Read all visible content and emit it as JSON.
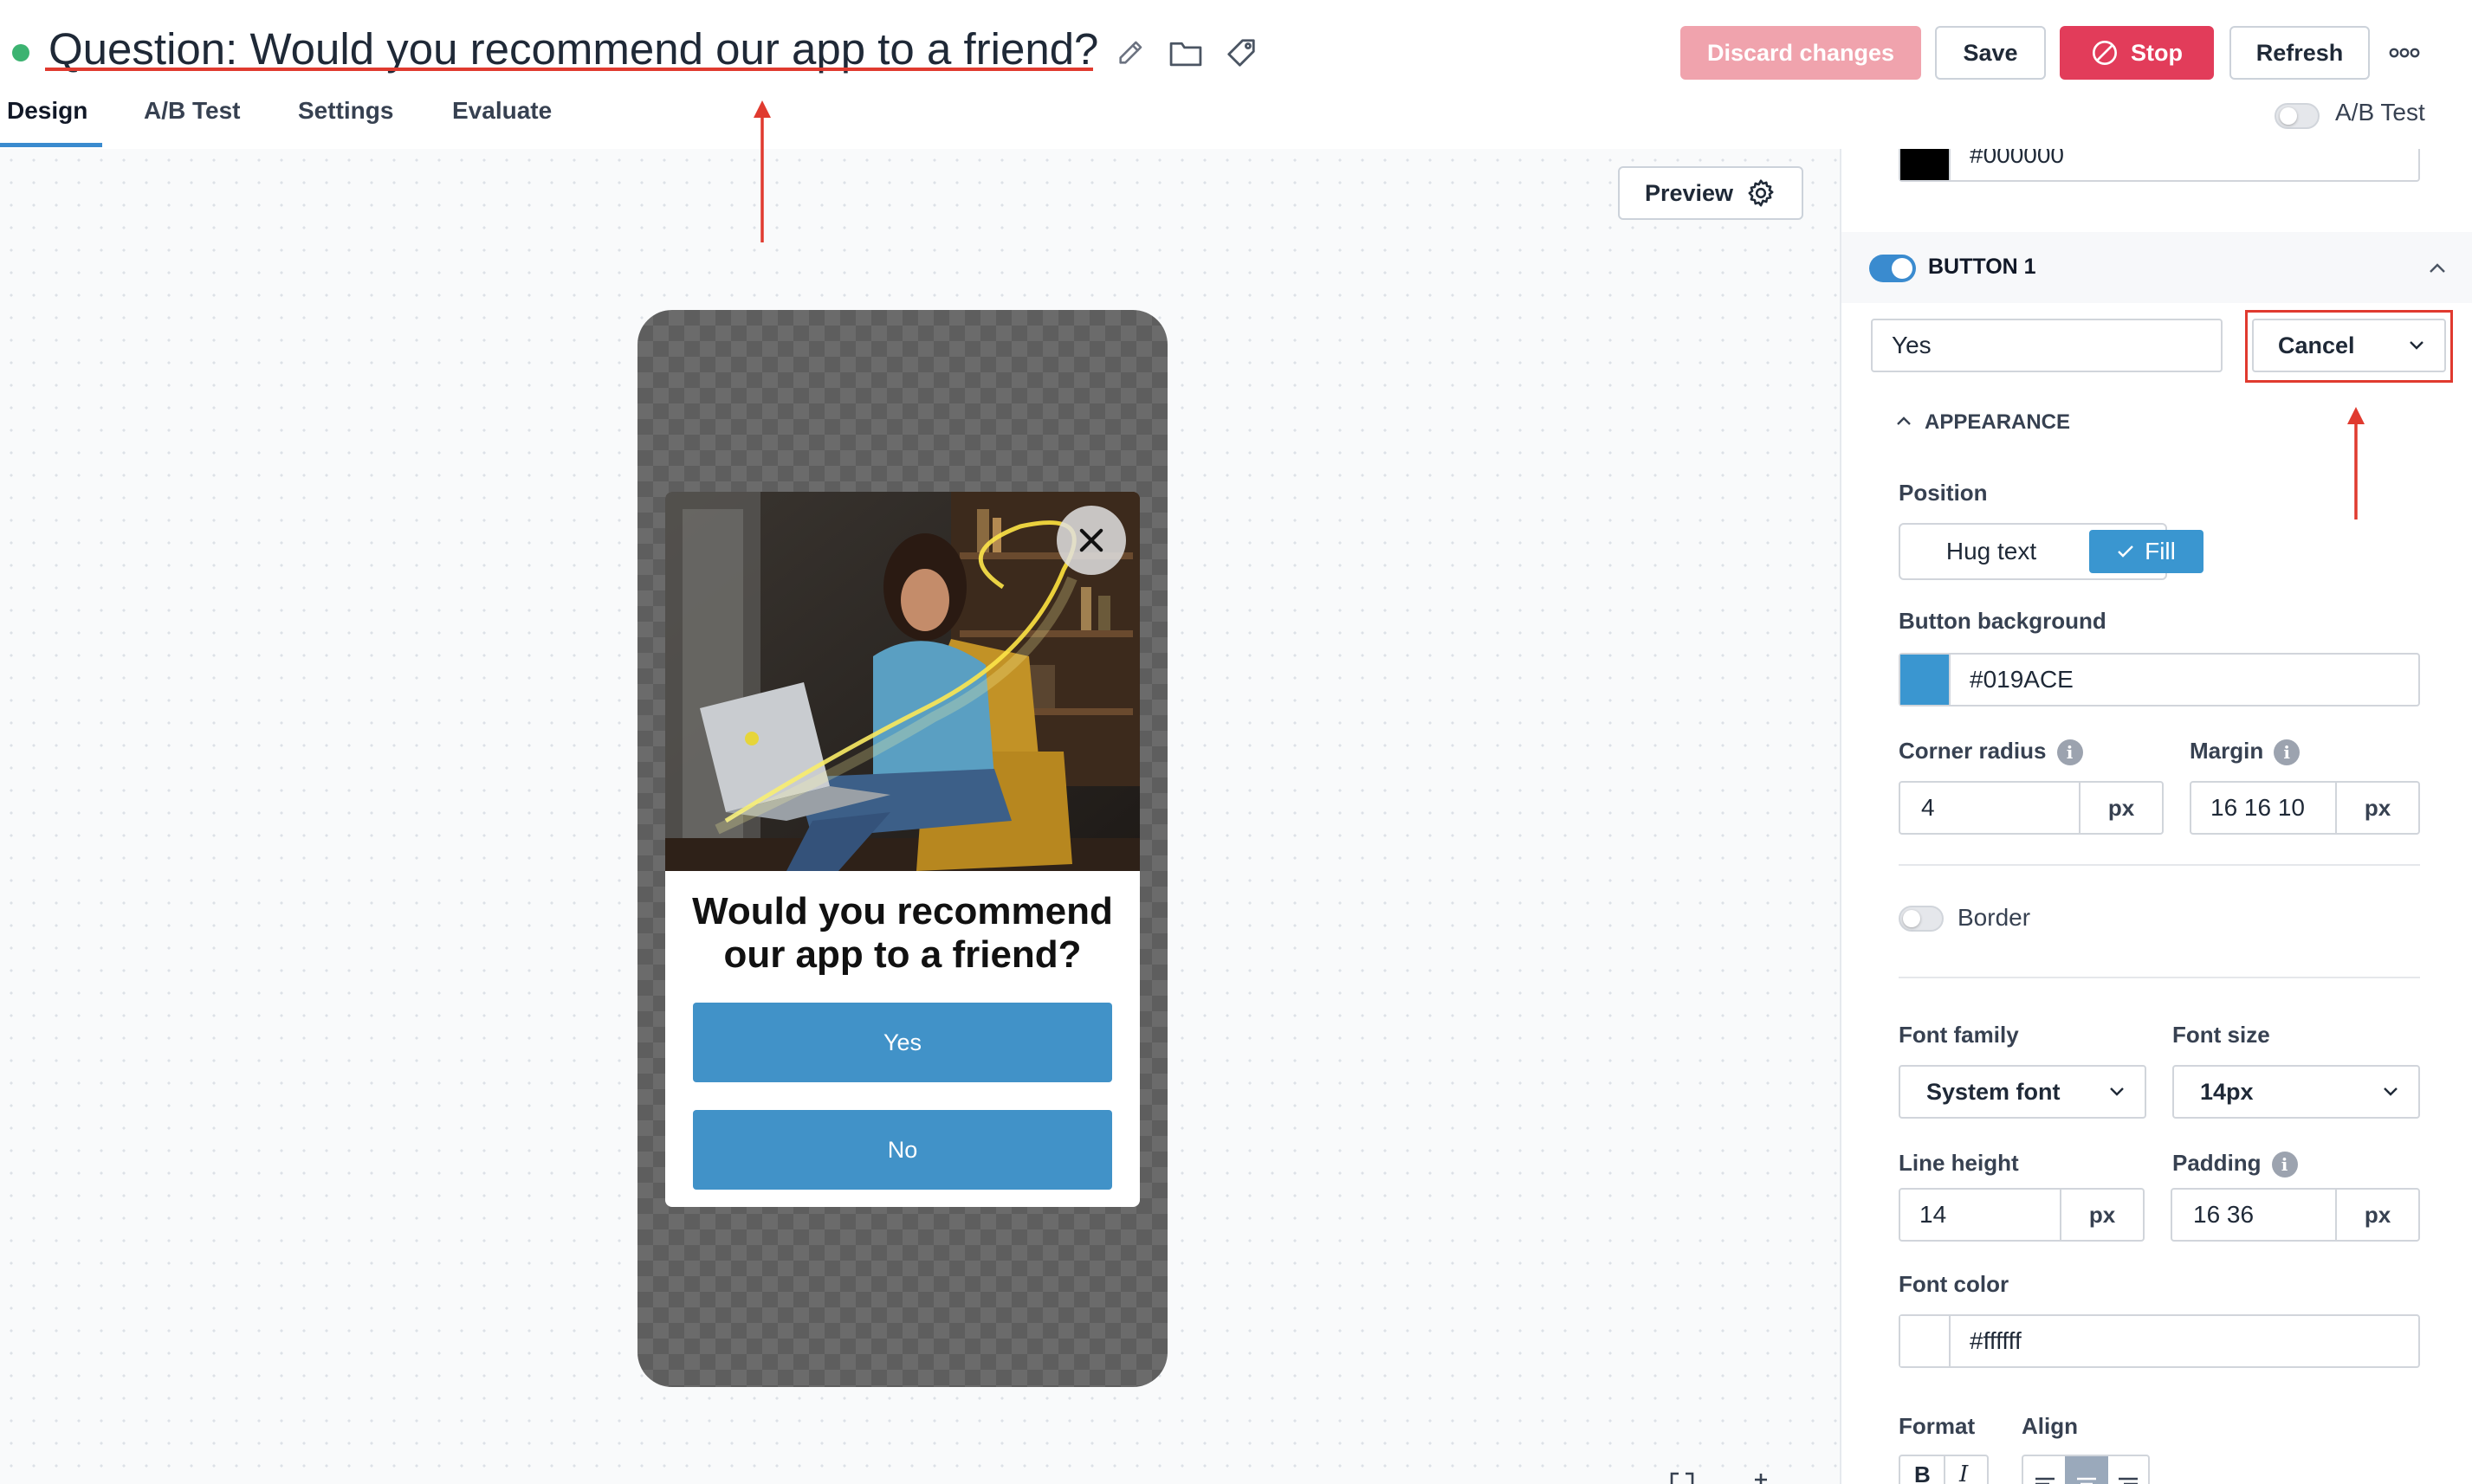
{
  "header": {
    "title": "Question: Would you recommend our app to a friend?",
    "discard_label": "Discard changes",
    "save_label": "Save",
    "stop_label": "Stop",
    "refresh_label": "Refresh",
    "status_color": "#3cb371"
  },
  "tabs": [
    {
      "label": "Design",
      "active": true
    },
    {
      "label": "A/B Test",
      "active": false
    },
    {
      "label": "Settings",
      "active": false
    },
    {
      "label": "Evaluate",
      "active": false
    }
  ],
  "ab_toggle": {
    "label": "A/B Test",
    "enabled": false
  },
  "canvas": {
    "preview_label": "Preview",
    "popup": {
      "question": "Would you recommend our app to a friend?",
      "button_yes": "Yes",
      "button_no": "No"
    }
  },
  "panel": {
    "prev_color_value": "#000000",
    "button_section": {
      "title": "BUTTON 1",
      "enabled": true
    },
    "button_text": "Yes",
    "action_select": "Cancel",
    "appearance_label": "APPEARANCE",
    "position": {
      "label": "Position",
      "options": [
        "Hug text",
        "Fill"
      ],
      "selected": "Fill"
    },
    "button_background": {
      "label": "Button background",
      "value": "#019ACE",
      "swatch": "#3a96d0"
    },
    "corner_radius": {
      "label": "Corner radius",
      "value": "4",
      "unit": "px"
    },
    "margin": {
      "label": "Margin",
      "value": "16 16 10",
      "unit": "px"
    },
    "border": {
      "label": "Border",
      "enabled": false
    },
    "font_family": {
      "label": "Font family",
      "value": "System font"
    },
    "font_size": {
      "label": "Font size",
      "value": "14px"
    },
    "line_height": {
      "label": "Line height",
      "value": "14",
      "unit": "px"
    },
    "padding": {
      "label": "Padding",
      "value": "16 36",
      "unit": "px"
    },
    "font_color": {
      "label": "Font color",
      "value": "#ffffff"
    },
    "format_label": "Format",
    "align_label": "Align",
    "info_glyph": "i"
  },
  "colors": {
    "accent": "#3a8bcf",
    "annotation": "#e03a2f",
    "stop": "#e23c5a"
  }
}
